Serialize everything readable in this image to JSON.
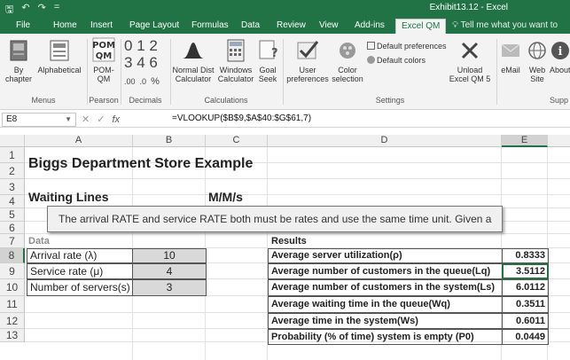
{
  "titlebar": {
    "title": "Exhibit13.12 - Excel",
    "save": "🖫",
    "undo": "↶",
    "redo": "↷",
    "customize": "="
  },
  "tabs": [
    "File",
    "Home",
    "Insert",
    "Page Layout",
    "Formulas",
    "Data",
    "Review",
    "View",
    "Add-ins",
    "Excel QM"
  ],
  "tell_me": "Tell me what you want to do...",
  "ribbon": {
    "by_chapter": [
      "By",
      "chapter"
    ],
    "alphabetical": "Alphabetical",
    "menus_group": "Menus",
    "pom_qm": [
      "POM-",
      "QM"
    ],
    "pearson_group": "Pearson",
    "decimals_group": "Decimals",
    "dec_digits": [
      "0",
      "1",
      "2",
      "3",
      "4",
      "6"
    ],
    "dec_small": [
      ".00",
      ".0",
      "%"
    ],
    "normal_dist": [
      "Normal Dist",
      "Calculator"
    ],
    "windows_calc": [
      "Windows",
      "Calculator"
    ],
    "goal_seek": [
      "Goal",
      "Seek"
    ],
    "calculations_group": "Calculations",
    "user_prefs": [
      "User",
      "preferences"
    ],
    "color_sel": [
      "Color",
      "selection"
    ],
    "default_prefs": "Default preferences",
    "default_colors": "Default colors",
    "settings_group": "Settings",
    "unload": [
      "Unload",
      "Excel QM 5"
    ],
    "email": "eMail",
    "web_site": [
      "Web",
      "Site"
    ],
    "about": "About",
    "supp_group": "Supp"
  },
  "formula_bar": {
    "name_box": "E8",
    "fx": "fx",
    "formula": "=VLOOKUP($B$9,$A$40:$G$61,7)"
  },
  "columns": [
    "A",
    "B",
    "C",
    "D",
    "E"
  ],
  "rows": [
    "1",
    "2",
    "3",
    "4",
    "5",
    "6",
    "7",
    "8",
    "9",
    "10",
    "11",
    "12",
    "13"
  ],
  "sheet": {
    "title": "Biggs Department Store Example",
    "waiting_lines": "Waiting Lines",
    "model": "M/M/s",
    "data_header": "Data",
    "results_header": "Results",
    "inputs": [
      {
        "label": "Arrival rate (λ)",
        "value": "10"
      },
      {
        "label": "Service rate (μ)",
        "value": "4"
      },
      {
        "label": "Number of servers(s)",
        "value": "3"
      }
    ],
    "results": [
      {
        "label": "Average server utilization(ρ)",
        "value": "0.8333"
      },
      {
        "label": "Average number of customers in the queue(Lq)",
        "value": "3.5112"
      },
      {
        "label": "Average number of customers in the system(Ls)",
        "value": "6.0112"
      },
      {
        "label": "Average waiting time in the queue(Wq)",
        "value": "0.3511"
      },
      {
        "label": "Average time in the system(Ws)",
        "value": "0.6011"
      },
      {
        "label": "Probability (% of time) system is empty (P0)",
        "value": "0.0449"
      }
    ]
  },
  "tooltip": "The arrival RATE and service RATE both must be rates and use the same time unit. Given a"
}
